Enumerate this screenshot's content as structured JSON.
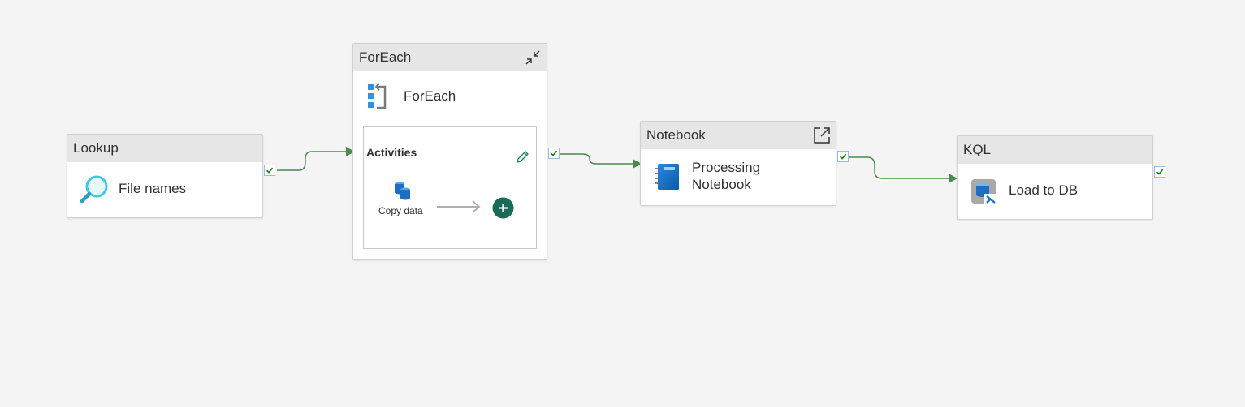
{
  "colors": {
    "canvas": "#f4f4f4",
    "header": "#e6e6e6",
    "connector": "#4c8a4c",
    "success_check": "#107c10",
    "add_button": "#1a6b5a"
  },
  "lookup": {
    "header": "Lookup",
    "label": "File names",
    "icon": "lookup-search-icon"
  },
  "foreach": {
    "header": "ForEach",
    "label": "ForEach",
    "icon": "foreach-icon",
    "collapse_icon": "collapse-icon",
    "activities_title": "Activities",
    "edit_icon": "pencil-icon",
    "inner_activity_label": "Copy data",
    "inner_activity_icon": "copy-data-icon",
    "add_icon": "add-activity-icon"
  },
  "notebook": {
    "header": "Notebook",
    "label_line1": "Processing",
    "label_line2": "Notebook",
    "icon": "notebook-icon",
    "open_icon": "open-external-icon"
  },
  "kql": {
    "header": "KQL",
    "label": "Load to DB",
    "icon": "kql-database-icon"
  }
}
